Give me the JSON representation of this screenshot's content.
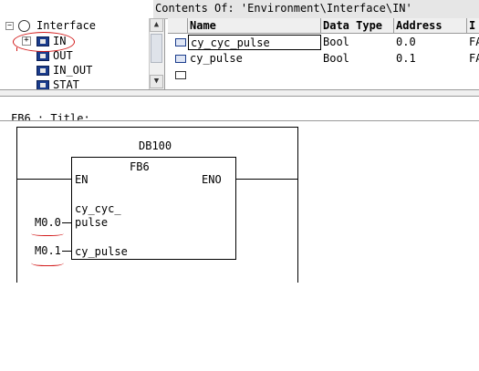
{
  "tree": {
    "root_label": "Interface",
    "items": [
      {
        "label": "IN",
        "expander": "+"
      },
      {
        "label": "OUT"
      },
      {
        "label": "IN_OUT"
      },
      {
        "label": "STAT"
      }
    ]
  },
  "contents_title": "Contents Of: 'Environment\\Interface\\IN'",
  "table": {
    "columns": [
      "Name",
      "Data Type",
      "Address",
      "I"
    ],
    "rows": [
      {
        "name": "cy_cyc_pulse",
        "type": "Bool",
        "address": "0.0",
        "extra": "FA"
      },
      {
        "name": "cy_pulse",
        "type": "Bool",
        "address": "0.1",
        "extra": "FA"
      }
    ]
  },
  "network_title": "FB6 : Title:",
  "block": {
    "db": "DB100",
    "fb": "FB6",
    "en": "EN",
    "eno": "ENO",
    "pin1_line1": "cy_cyc_",
    "pin1_line2": "pulse",
    "pin2": "cy_pulse",
    "operand1": "M0.0",
    "operand2": "M0.1"
  }
}
